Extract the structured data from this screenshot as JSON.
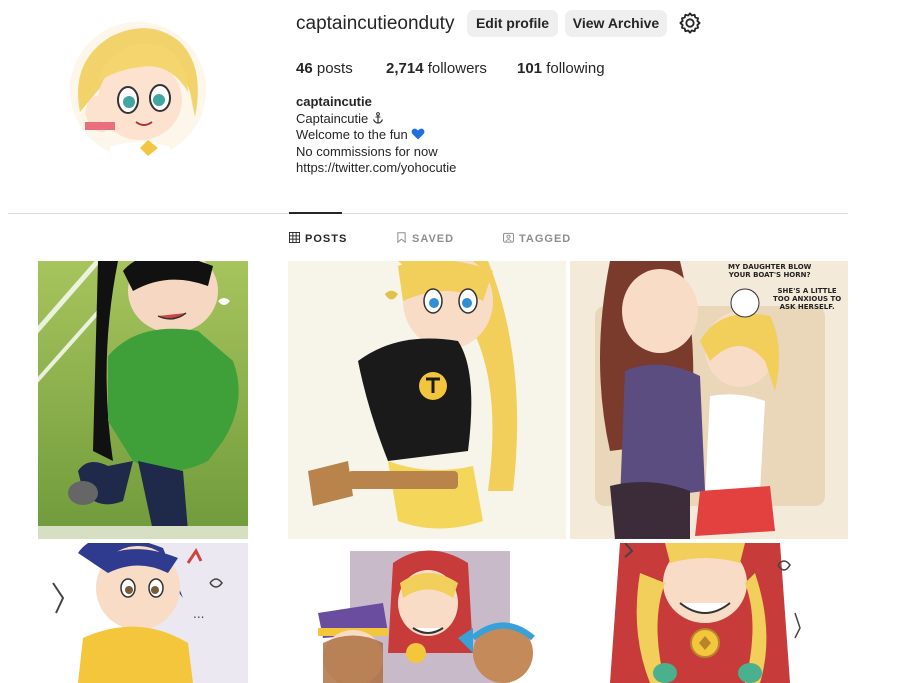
{
  "profile": {
    "username": "captaincutieonduty",
    "edit_profile_label": "Edit profile",
    "view_archive_label": "View Archive",
    "stats": {
      "posts_count": "46",
      "posts_label": "posts",
      "followers_count": "2,714",
      "followers_label": "followers",
      "following_count": "101",
      "following_label": "following"
    },
    "bio": {
      "name": "captaincutie",
      "line1": "Captaincutie",
      "line1_icon": "anchor-icon",
      "line2": "Welcome to the fun",
      "line2_icon": "blue-heart-icon",
      "line3": "No commissions for now",
      "link": "https://twitter.com/yohocutie"
    }
  },
  "tabs": [
    {
      "label": "POSTS",
      "icon": "grid-icon",
      "active": true
    },
    {
      "label": "SAVED",
      "icon": "bookmark-icon",
      "active": false
    },
    {
      "label": "TAGGED",
      "icon": "tag-portrait-icon",
      "active": false
    }
  ],
  "posts": {
    "post3_text1": "MY DAUGHTER BLOW\nYOUR BOAT'S HORN?",
    "post3_text2": "SHE'S A LITTLE\nTOO ANXIOUS TO\nASK HERSELF."
  },
  "colors": {
    "accent_heart": "#1f6fe0",
    "button_bg": "#efefef",
    "divider": "#dbdbdb"
  }
}
